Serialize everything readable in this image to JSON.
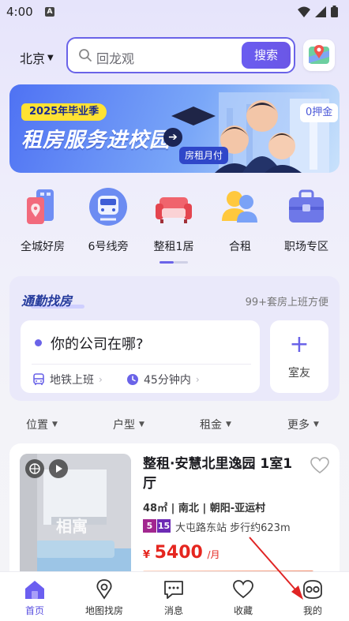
{
  "status_bar": {
    "time": "4:00",
    "notif_letter": "A"
  },
  "header": {
    "city": "北京",
    "search_placeholder": "回龙观",
    "search_button": "搜索"
  },
  "banner": {
    "tag": "2025年毕业季",
    "title": "租房服务进校园",
    "pay_badge": "房租月付",
    "deposit_badge": "0押金"
  },
  "categories": [
    {
      "label": "全城好房",
      "icon": "city-house-icon"
    },
    {
      "label": "6号线旁",
      "icon": "subway-train-icon"
    },
    {
      "label": "整租1居",
      "icon": "sofa-icon"
    },
    {
      "label": "合租",
      "icon": "roommates-icon"
    },
    {
      "label": "职场专区",
      "icon": "briefcase-icon"
    }
  ],
  "commute": {
    "title": "通勤找房",
    "subtitle": "99+套房上班方便",
    "question": "你的公司在哪?",
    "option_transport": "地铁上班",
    "option_time": "45分钟内",
    "roommate_label": "室友"
  },
  "filters": [
    "位置",
    "户型",
    "租金",
    "更多"
  ],
  "listing": {
    "title": "整租·安慧北里逸园 1室1厅",
    "area": "48㎡",
    "orientation": "南北",
    "district": "朝阳-亚运村",
    "meta_sep": " | ",
    "lines": [
      "5",
      "15"
    ],
    "station_text": "大屯路东站 步行约623m",
    "price_currency": "¥",
    "price": "5400",
    "price_unit": "/月",
    "watermark": "相寓"
  },
  "bottom_nav": [
    {
      "label": "首页",
      "icon": "home-icon",
      "active": true
    },
    {
      "label": "地图找房",
      "icon": "map-pin-icon",
      "active": false
    },
    {
      "label": "消息",
      "icon": "message-icon",
      "active": false
    },
    {
      "label": "收藏",
      "icon": "heart-icon",
      "active": false
    },
    {
      "label": "我的",
      "icon": "profile-icon",
      "active": false
    }
  ],
  "colors": {
    "accent": "#6a63e8",
    "price": "#e5261f",
    "line5": "#a2278f",
    "line15": "#6d2bb5"
  }
}
